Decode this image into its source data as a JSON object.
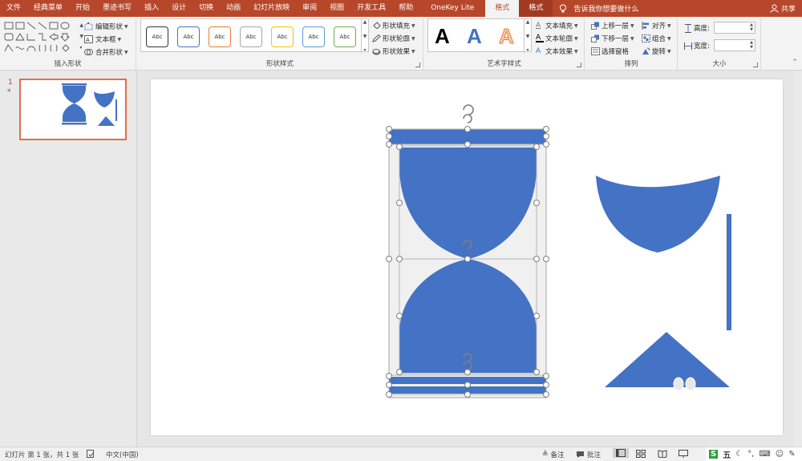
{
  "menubar": {
    "tabs": [
      "文件",
      "经典菜单",
      "开始",
      "墨迹书写",
      "插入",
      "设计",
      "切换",
      "动画",
      "幻灯片放映",
      "审阅",
      "视图",
      "开发工具",
      "帮助",
      "OneKey Lite",
      "格式",
      "格式"
    ],
    "active_tab_index": 14,
    "tell_me": "告诉我你想要做什么",
    "share": "共享"
  },
  "ribbon": {
    "insert_shapes": {
      "label": "插入形状",
      "edit_shape": "编辑形状",
      "text_box": "文本框",
      "merge_shapes": "合并形状"
    },
    "shape_styles": {
      "label": "形状样式",
      "sample_text": "Abc",
      "swatches": [
        "#333333",
        "#4472c4",
        "#ed7d31",
        "#a5a5a5",
        "#ffc000",
        "#5b9bd5",
        "#70ad47"
      ],
      "fill": "形状填充",
      "outline": "形状轮廓",
      "effects": "形状效果"
    },
    "wordart_styles": {
      "label": "艺术字样式",
      "letters": [
        "A",
        "A",
        "A"
      ],
      "text_fill": "文本填充",
      "text_outline": "文本轮廓",
      "text_effects": "文本效果"
    },
    "arrange": {
      "label": "排列",
      "bring_forward": "上移一层",
      "send_backward": "下移一层",
      "selection_pane": "选择窗格",
      "align": "对齐",
      "group": "组合",
      "rotate": "旋转"
    },
    "size": {
      "label": "大小",
      "height_label": "高度:",
      "width_label": "宽度:",
      "height_value": "",
      "width_value": ""
    }
  },
  "thumbnails": {
    "slide_number": "1",
    "star": "*"
  },
  "statusbar": {
    "slide_info": "幻灯片 第 1 张，共 1 张",
    "language": "中文(中国)",
    "notes": "备注",
    "comments": "批注",
    "ime_label": "五"
  },
  "colors": {
    "accent": "#b7472a",
    "shape_blue": "#4472c4",
    "selection_grey": "#f0f0f0"
  }
}
